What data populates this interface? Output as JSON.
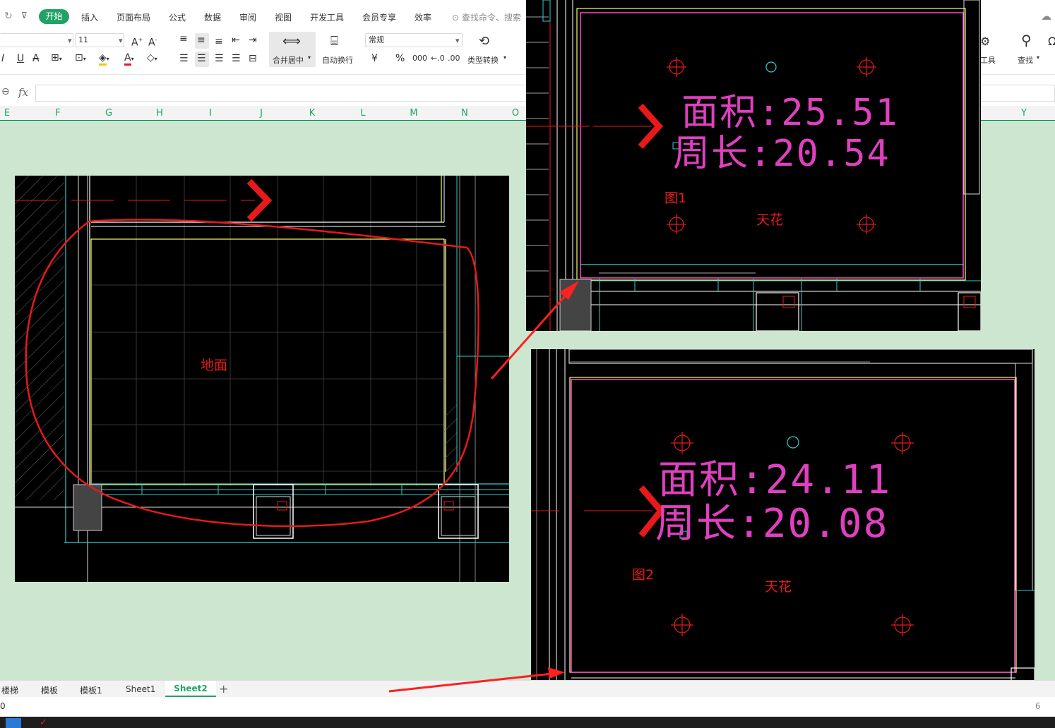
{
  "menu": {
    "items": [
      "开始",
      "插入",
      "页面布局",
      "公式",
      "数据",
      "审阅",
      "视图",
      "开发工具",
      "会员专享",
      "效率"
    ],
    "search_placeholder": "查找命令、搜索"
  },
  "ribbon": {
    "font_size": "11",
    "number_format": "常规",
    "merge_center": "合并居中",
    "wrap_text": "自动换行",
    "type_convert": "类型转换",
    "find": "查找",
    "tools": "工具",
    "currency_symbol": "¥",
    "percent_symbol": "%",
    "thousands_symbol": "000",
    "accent_color": "#21a366"
  },
  "formula_bar": {
    "fx_label": "fx",
    "value": ""
  },
  "columns": [
    "E",
    "F",
    "G",
    "H",
    "I",
    "J",
    "K",
    "L",
    "M",
    "N",
    "O",
    "Y"
  ],
  "sheet_tabs": [
    "楼梯",
    "模板",
    "模板1",
    "Sheet1",
    "Sheet2"
  ],
  "active_sheet": "Sheet2",
  "status_left": "0",
  "status_right": "6",
  "images": {
    "floor_plan": {
      "label": "地面"
    },
    "ceiling_1": {
      "area": "面积:25.51",
      "perimeter": "周长:20.54",
      "figure": "图1",
      "label": "天花"
    },
    "ceiling_2": {
      "area": "面积:24.11",
      "perimeter": "周长:20.08",
      "figure": "图2",
      "label": "天花"
    }
  }
}
